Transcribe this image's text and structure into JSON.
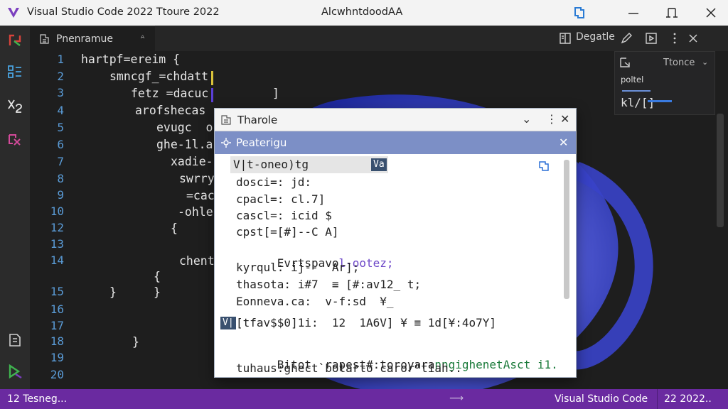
{
  "titlebar": {
    "app_title": "Visual Studio Code 2022  Ttoure 2022",
    "center_title": "AlcwhntdoodAA",
    "brand_color": "#7b3fbf"
  },
  "activity_icons": [
    "branch-icon",
    "source-control-icon",
    "debug-icon",
    "extensions-icon",
    "explorer-icon",
    "run-icon"
  ],
  "tab": {
    "label": "Pnenramue",
    "close_glyph": "ᴬ"
  },
  "editor_toolbar": {
    "label": "Degatle"
  },
  "editor": {
    "line_numbers": [
      "1",
      "2",
      "3",
      "4",
      "5",
      "6",
      "7",
      "8",
      "9",
      "10",
      "12",
      "13",
      "14",
      "15",
      "16",
      "17",
      "18",
      "19",
      "20"
    ],
    "lines": [
      {
        "text": "hartpf=ereim {"
      },
      {
        "text": "smncgf_=chdatt"
      },
      {
        "text": "fetz =dacuc"
      },
      {
        "text": "arofshecas"
      },
      {
        "text": "evugc  o"
      },
      {
        "text": "ghe-1l.a"
      },
      {
        "text": "xadie-"
      },
      {
        "text": "swrry"
      },
      {
        "text": "=cac"
      },
      {
        "text": "-ohle"
      },
      {
        "text": "{"
      },
      {
        "text": "chent"
      },
      {
        "text": "{"
      },
      {
        "text": "}"
      },
      {
        "text": "}"
      },
      {
        "text": "}"
      }
    ],
    "stray_bracket": "]"
  },
  "peek": {
    "label": "Ttonce",
    "sub": "poltel",
    "value": "kl/[]"
  },
  "dialog": {
    "title": "Tharole",
    "subheader": "Peaterigu",
    "selected_item": "V|t-oneo)tg",
    "chip_left": "V|",
    "chip_right": "Va",
    "lines": [
      "dosci=: jd:",
      "cpacl=: cl.7]",
      "cascl=: icid $",
      "cpst[=[#]--C A]",
      "Evrtspavo",
      "kyrqul: ij--  Ar];",
      "thasota: i#7  ≡ [#:av12_ t;",
      "Eonneva.ca:  v-f:sd  ¥_",
      "[tfav$$0]1i:  12  1A6V] ¥ ≡ 1d[¥:4o7Y]",
      "Bitot  rapest#:toroyara",
      "tuhaus:ghect`botarto caror\"tiah.."
    ],
    "purple_tail": "l-ootez;",
    "green_tail": "nngighenetAsct i1.",
    "accent_purple": "#6b45c7",
    "accent_green": "#1a7a3a"
  },
  "statusbar": {
    "left": "12 Tesneg...",
    "right_app": "Visual Studio Code",
    "right_date": "22 2022..",
    "color": "#6a2aa0"
  }
}
